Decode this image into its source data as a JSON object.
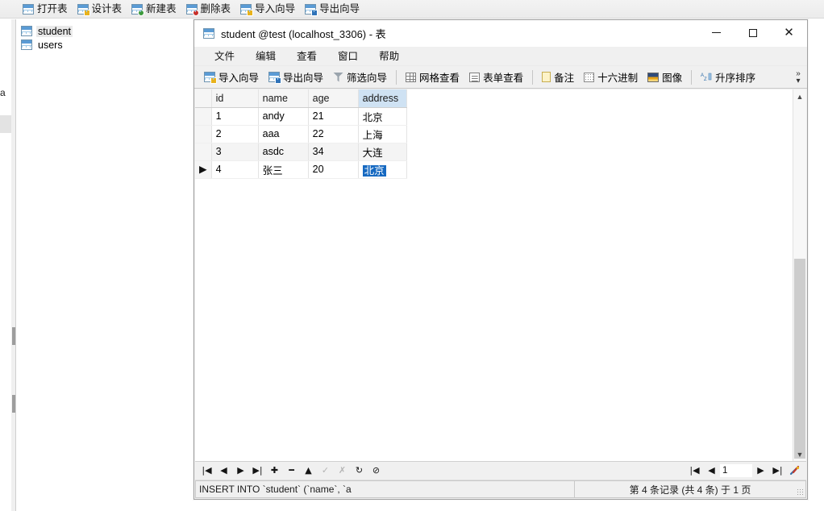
{
  "app": {
    "main_toolbar": [
      {
        "label": "打开表",
        "icon": "open-table-icon",
        "badge": "none"
      },
      {
        "label": "设计表",
        "icon": "design-table-icon",
        "badge": "pencil"
      },
      {
        "label": "新建表",
        "icon": "new-table-icon",
        "badge": "green-plus"
      },
      {
        "label": "删除表",
        "icon": "delete-table-icon",
        "badge": "red-cross"
      },
      {
        "label": "导入向导",
        "icon": "import-wizard-icon",
        "badge": "yellow"
      },
      {
        "label": "导出向导",
        "icon": "export-wizard-icon",
        "badge": "blue"
      }
    ],
    "tree": {
      "items": [
        {
          "label": "student",
          "icon": "table-icon",
          "selected": true
        },
        {
          "label": "users",
          "icon": "table-icon",
          "selected": false
        }
      ]
    },
    "left_edge_fragment": "a"
  },
  "window": {
    "title": "student @test (localhost_3306) - 表",
    "title_icon": "table-icon",
    "controls": {
      "minimize": "minimize-button",
      "maximize": "maximize-button",
      "close": "close-button"
    },
    "menu": [
      "文件",
      "编辑",
      "查看",
      "窗口",
      "帮助"
    ],
    "toolbar": {
      "groups": [
        [
          {
            "label": "导入向导",
            "icon": "import-wizard-icon"
          },
          {
            "label": "导出向导",
            "icon": "export-wizard-icon"
          },
          {
            "label": "筛选向导",
            "icon": "filter-funnel-icon"
          }
        ],
        [
          {
            "label": "网格查看",
            "icon": "grid-view-icon"
          },
          {
            "label": "表单查看",
            "icon": "form-view-icon"
          }
        ],
        [
          {
            "label": "备注",
            "icon": "memo-icon"
          },
          {
            "label": "十六进制",
            "icon": "hex-icon"
          },
          {
            "label": "图像",
            "icon": "image-icon"
          }
        ],
        [
          {
            "label": "升序排序",
            "icon": "sort-ascending-icon"
          }
        ]
      ],
      "overflow": "»"
    }
  },
  "grid": {
    "columns": [
      "id",
      "name",
      "age",
      "address"
    ],
    "active_column": "address",
    "rows": [
      {
        "marker": "",
        "id": "1",
        "name": "andy",
        "age": "21",
        "address": "北京",
        "alt": false,
        "current": false
      },
      {
        "marker": "",
        "id": "2",
        "name": "aaa",
        "age": "22",
        "address": "上海",
        "alt": false,
        "current": false
      },
      {
        "marker": "",
        "id": "3",
        "name": "asdc",
        "age": "34",
        "address": "大连",
        "alt": true,
        "current": false
      },
      {
        "marker": "▶",
        "id": "4",
        "name": "张三",
        "age": "20",
        "address": "北京",
        "alt": false,
        "current": true
      }
    ],
    "selected_cell": {
      "row": 4,
      "column": "address",
      "value": "北京"
    }
  },
  "nav_bar": {
    "buttons": [
      {
        "name": "first-record-button",
        "glyph": "|◀",
        "enabled": true
      },
      {
        "name": "prev-record-button",
        "glyph": "◀",
        "enabled": true
      },
      {
        "name": "next-record-button",
        "glyph": "▶",
        "enabled": true
      },
      {
        "name": "last-record-button",
        "glyph": "▶|",
        "enabled": true
      },
      {
        "name": "add-record-button",
        "glyph": "✚",
        "enabled": true
      },
      {
        "name": "delete-record-button",
        "glyph": "━",
        "enabled": true
      },
      {
        "name": "edit-record-button",
        "glyph": "▲",
        "enabled": true
      },
      {
        "name": "apply-change-button",
        "glyph": "✓",
        "enabled": false
      },
      {
        "name": "cancel-change-button",
        "glyph": "✗",
        "enabled": false
      },
      {
        "name": "refresh-button",
        "glyph": "↻",
        "enabled": true
      },
      {
        "name": "stop-button",
        "glyph": "⊘",
        "enabled": true
      }
    ],
    "pager": {
      "first": "|◀",
      "prev": "◀",
      "page_value": "1",
      "next": "▶",
      "last": "▶|",
      "tools": "wrench-icon"
    }
  },
  "status_bar": {
    "sql": "INSERT INTO `student` (`name`, `a",
    "record_info": "第 4 条记录 (共 4 条) 于 1 页"
  },
  "colors": {
    "accent_selection": "#1669c1",
    "active_column_header": "#cfe2f3",
    "toolbar_bg": "#f0f0f0",
    "alt_row": "#f4f4f4"
  }
}
